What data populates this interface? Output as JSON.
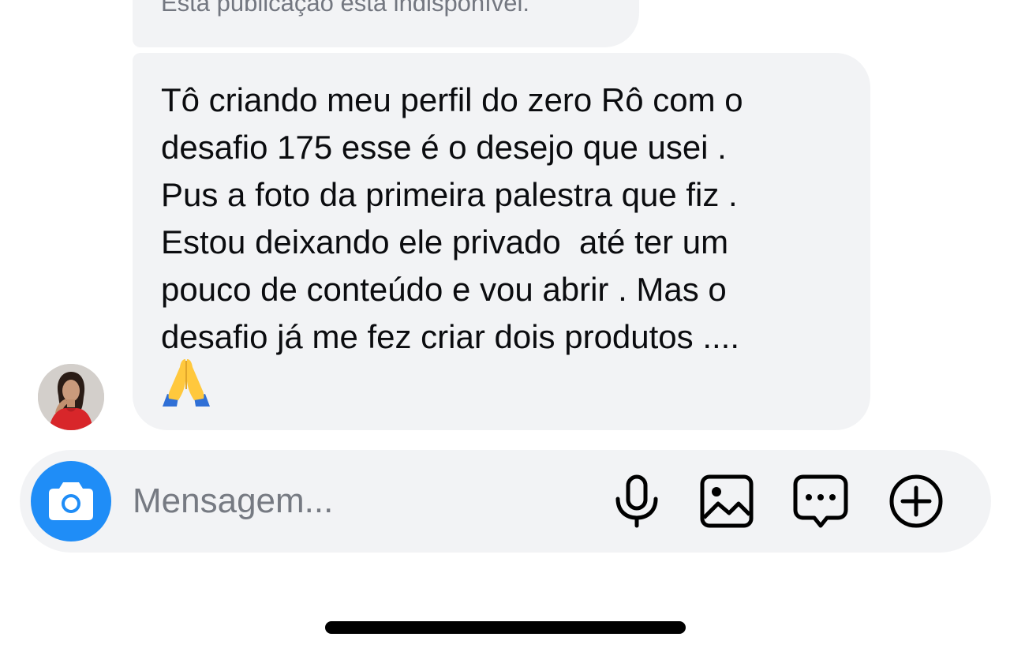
{
  "conversation": {
    "unavailable_post_notice": "Esta publicação está indisponível.",
    "message": {
      "lines": [
        "Tô criando meu perfil do zero Rô com o",
        "desafio 175 esse é o desejo que usei .",
        "Pus a foto da primeira palestra que fiz .",
        "Estou deixando ele privado  até ter um",
        "pouco de conteúdo e vou abrir . Mas o",
        "desafio já me fez criar dois produtos ...."
      ],
      "emoji": "folded-hands-emoji"
    },
    "sender_avatar": "avatar-icon"
  },
  "composer": {
    "placeholder": "Mensagem...",
    "camera_icon": "camera-icon",
    "tools": [
      "microphone-icon",
      "gallery-icon",
      "sticker-chat-icon",
      "plus-icon"
    ]
  },
  "colors": {
    "bubble_bg": "#f2f3f5",
    "camera_button": "#1f8df7",
    "text": "#0b0c0f",
    "placeholder": "#767a82",
    "emoji_hands": "#ffc83d",
    "emoji_sleeve": "#2f6fd6"
  }
}
